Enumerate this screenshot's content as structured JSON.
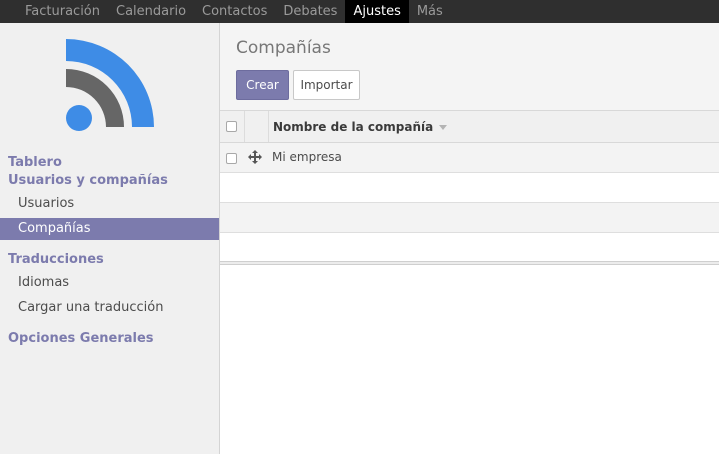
{
  "topbar": {
    "items": [
      "Facturación",
      "Calendario",
      "Contactos",
      "Debates",
      "Ajustes",
      "Más"
    ],
    "active_index": 4
  },
  "colors": {
    "topbar_bg": "#2f2f2f",
    "accent": "#7c7bad",
    "logo_blue": "#3e8ce6",
    "logo_gray": "#666666"
  },
  "sidebar": {
    "logo_icon": "rss-feed-logo-icon",
    "sections": [
      {
        "label": "Tablero",
        "items": []
      },
      {
        "label": "Usuarios y compañías",
        "items": [
          "Usuarios",
          "Compañías"
        ]
      },
      {
        "label": "Traducciones",
        "items": [
          "Idiomas",
          "Cargar una traducción"
        ]
      },
      {
        "label": "Opciones Generales",
        "items": []
      }
    ],
    "active_item": "Compañías"
  },
  "main": {
    "title": "Compañías",
    "create_label": "Crear",
    "import_label": "Importar"
  },
  "table": {
    "columns": [
      "Nombre de la compañía"
    ],
    "sort_icon": "caret-down-icon",
    "row_icon": "move-icon",
    "rows": [
      {
        "name": "Mi empresa"
      }
    ]
  }
}
